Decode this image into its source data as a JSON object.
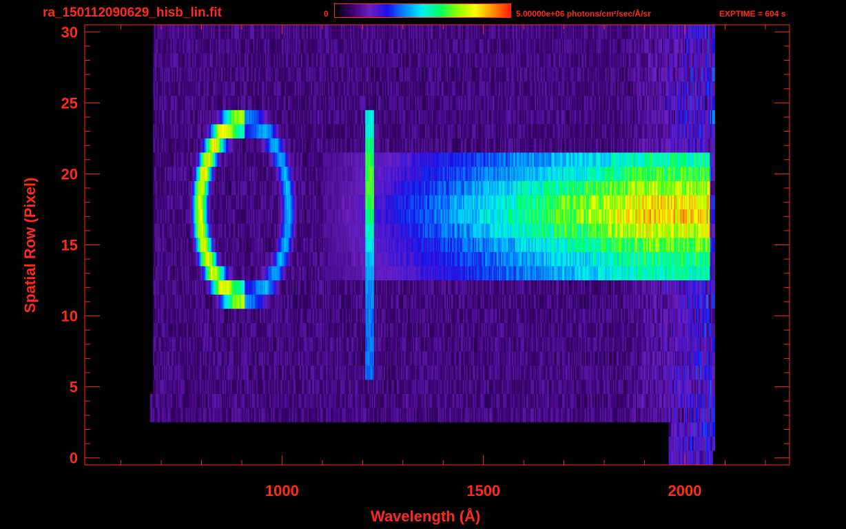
{
  "header": {
    "title": "ra_150112090629_hisb_lin.fit",
    "colorbar_min_label": "0",
    "colorbar_max_label": "5.00000e+06 photons/cm²/sec/Å/sr",
    "exptime_label": "EXPTIME = 604 s"
  },
  "chart_data": {
    "type": "heatmap",
    "xlabel": "Wavelength (Å)",
    "ylabel": "Spatial Row (Pixel)",
    "xlim": [
      510,
      2260
    ],
    "ylim": [
      -0.5,
      30.5
    ],
    "xticks": [
      1000,
      1500,
      2000
    ],
    "yticks": [
      0,
      5,
      10,
      15,
      20,
      25,
      30
    ],
    "colorbar": {
      "min": 0,
      "max": 5000000,
      "units": "photons/cm²/sec/Å/sr",
      "colors": [
        "#000000",
        "#3a0070",
        "#6a20c0",
        "#1a10e8",
        "#0090ff",
        "#00f0f0",
        "#00ff60",
        "#90ff00",
        "#ffff00",
        "#ff9000",
        "#ff1a00"
      ]
    },
    "grid": false,
    "data_extent_x": [
      680,
      2070
    ],
    "features": [
      {
        "name": "ring",
        "wavelength_range": [
          780,
          1040
        ],
        "rows": [
          11,
          24
        ],
        "peak_intensity": 0.85
      },
      {
        "name": "emission line",
        "wavelength": 1216,
        "rows": [
          6,
          24
        ],
        "peak_intensity": 0.55
      },
      {
        "name": "continuum",
        "wavelength_range": [
          1100,
          2060
        ],
        "rows": [
          13,
          21
        ],
        "peak_intensity": 0.95
      }
    ]
  },
  "colors": {
    "axis": "#ff2a1a",
    "background": "#000000"
  }
}
